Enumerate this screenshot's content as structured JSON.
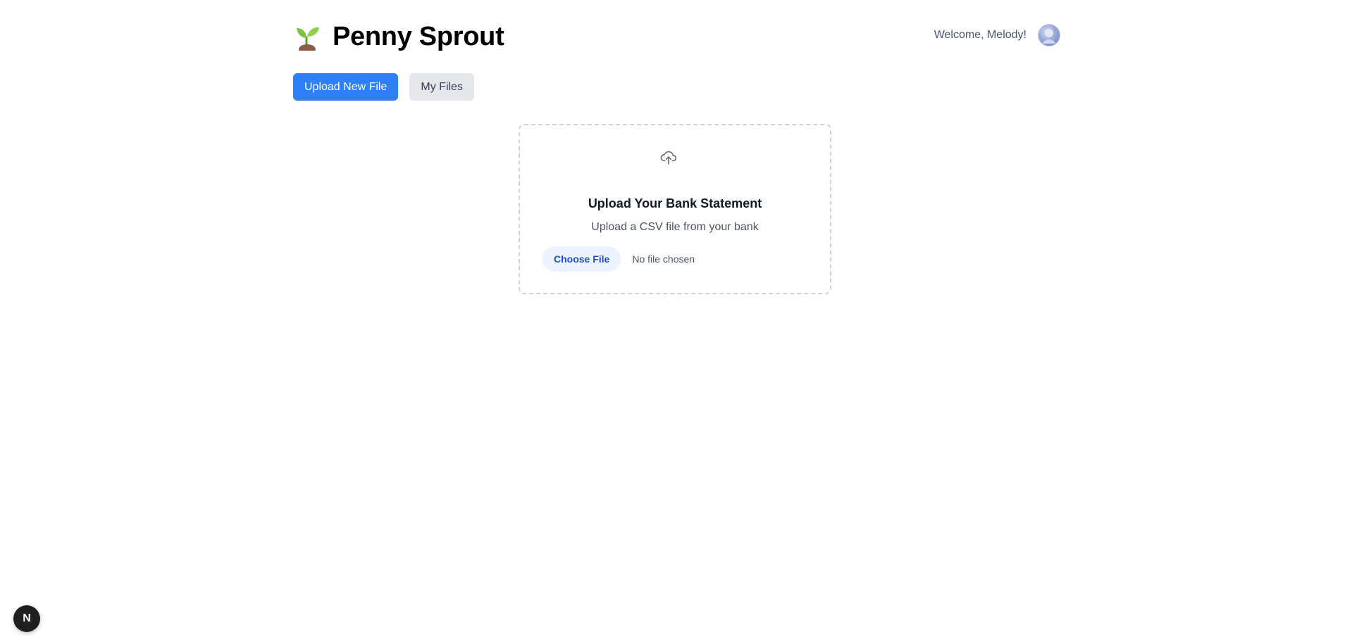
{
  "header": {
    "app_title": "Penny Sprout",
    "logo_icon": "sprout-icon",
    "welcome_text": "Welcome, Melody!",
    "avatar_icon": "user-avatar"
  },
  "tabs": [
    {
      "label": "Upload New File",
      "active": true
    },
    {
      "label": "My Files",
      "active": false
    }
  ],
  "upload": {
    "icon": "cloud-upload-icon",
    "title": "Upload Your Bank Statement",
    "subtitle": "Upload a CSV file from your bank",
    "choose_file_label": "Choose File",
    "file_status": "No file chosen"
  },
  "dev_badge": {
    "label": "N",
    "icon": "nextjs-icon"
  },
  "colors": {
    "accent": "#2f80f7",
    "tab_inactive_bg": "#e5e7eb",
    "choose_file_bg": "#eef4ff",
    "choose_file_text": "#1d4ed8"
  }
}
